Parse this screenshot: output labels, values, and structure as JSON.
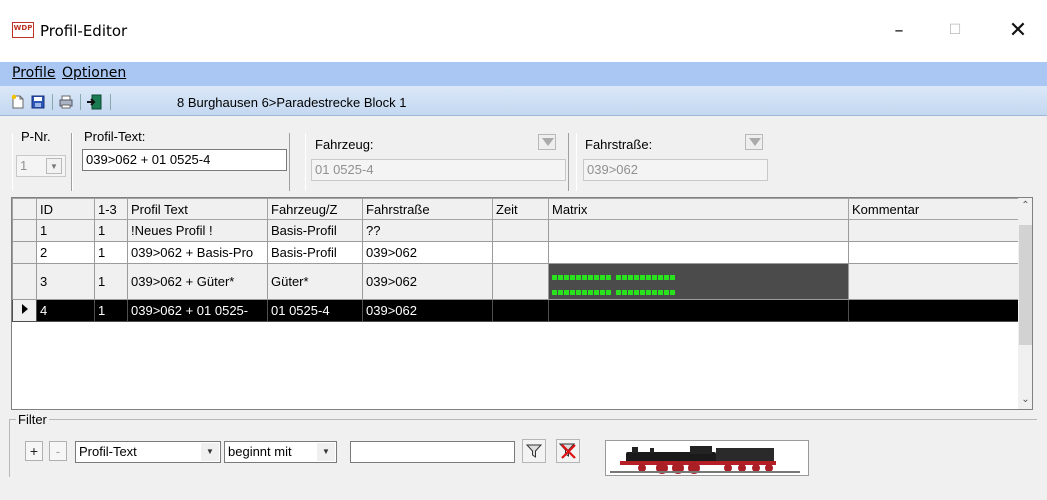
{
  "window": {
    "title": "Profil-Editor",
    "app_logo": "WDP",
    "minimize": "–",
    "maximize": "☐",
    "close": "✕"
  },
  "menu": {
    "profile": "Profile",
    "optionen": "Optionen"
  },
  "toolbar": {
    "path_text": "8 Burghausen 6>Paradestrecke Block 1",
    "icons": [
      "new-document-icon",
      "save-icon",
      "print-icon",
      "exit-icon"
    ]
  },
  "form": {
    "pnr_label": "P-Nr.",
    "pnr_value": "1",
    "profiltext_label": "Profil-Text:",
    "profiltext_value": "039>062 + 01 0525-4",
    "fahrzeug_label": "Fahrzeug:",
    "fahrzeug_value": "01 0525-4",
    "fahrstrasse_label": "Fahrstraße:",
    "fahrstrasse_value": "039>062"
  },
  "grid": {
    "columns": [
      "ID",
      "1-3",
      "Profil Text",
      "Fahrzeug/Z",
      "Fahrstraße",
      "Zeit",
      "Matrix",
      "Kommentar"
    ],
    "rows": [
      {
        "id": "1",
        "n": "1",
        "text": "!Neues Profil !",
        "fahrzeug": "Basis-Profil",
        "fahrstrasse": "??",
        "zeit": "",
        "matrix": "",
        "kommentar": ""
      },
      {
        "id": "2",
        "n": "1",
        "text": "039>062 + Basis-Pro",
        "fahrzeug": "Basis-Profil",
        "fahrstrasse": "039>062",
        "zeit": "",
        "matrix": "",
        "kommentar": ""
      },
      {
        "id": "3",
        "n": "1",
        "text": "039>062 + Güter*",
        "fahrzeug": "Güter*",
        "fahrstrasse": "039>062",
        "zeit": "",
        "matrix": "green-dots",
        "kommentar": ""
      },
      {
        "id": "4",
        "n": "1",
        "text": "039>062 + 01 0525-",
        "fahrzeug": "01 0525-4",
        "fahrstrasse": "039>062",
        "zeit": "",
        "matrix": "",
        "kommentar": ""
      }
    ],
    "selected_row": "4"
  },
  "filter": {
    "legend": "Filter",
    "plus": "+",
    "minus": "-",
    "field_value": "Profil-Text",
    "operator_value": "beginnt mit",
    "search_value": "",
    "loco_image": "steam-locomotive-image"
  },
  "colors": {
    "menubar": "#a9c7f2",
    "selection": "#000000",
    "matrix_dot": "#28e21e"
  }
}
